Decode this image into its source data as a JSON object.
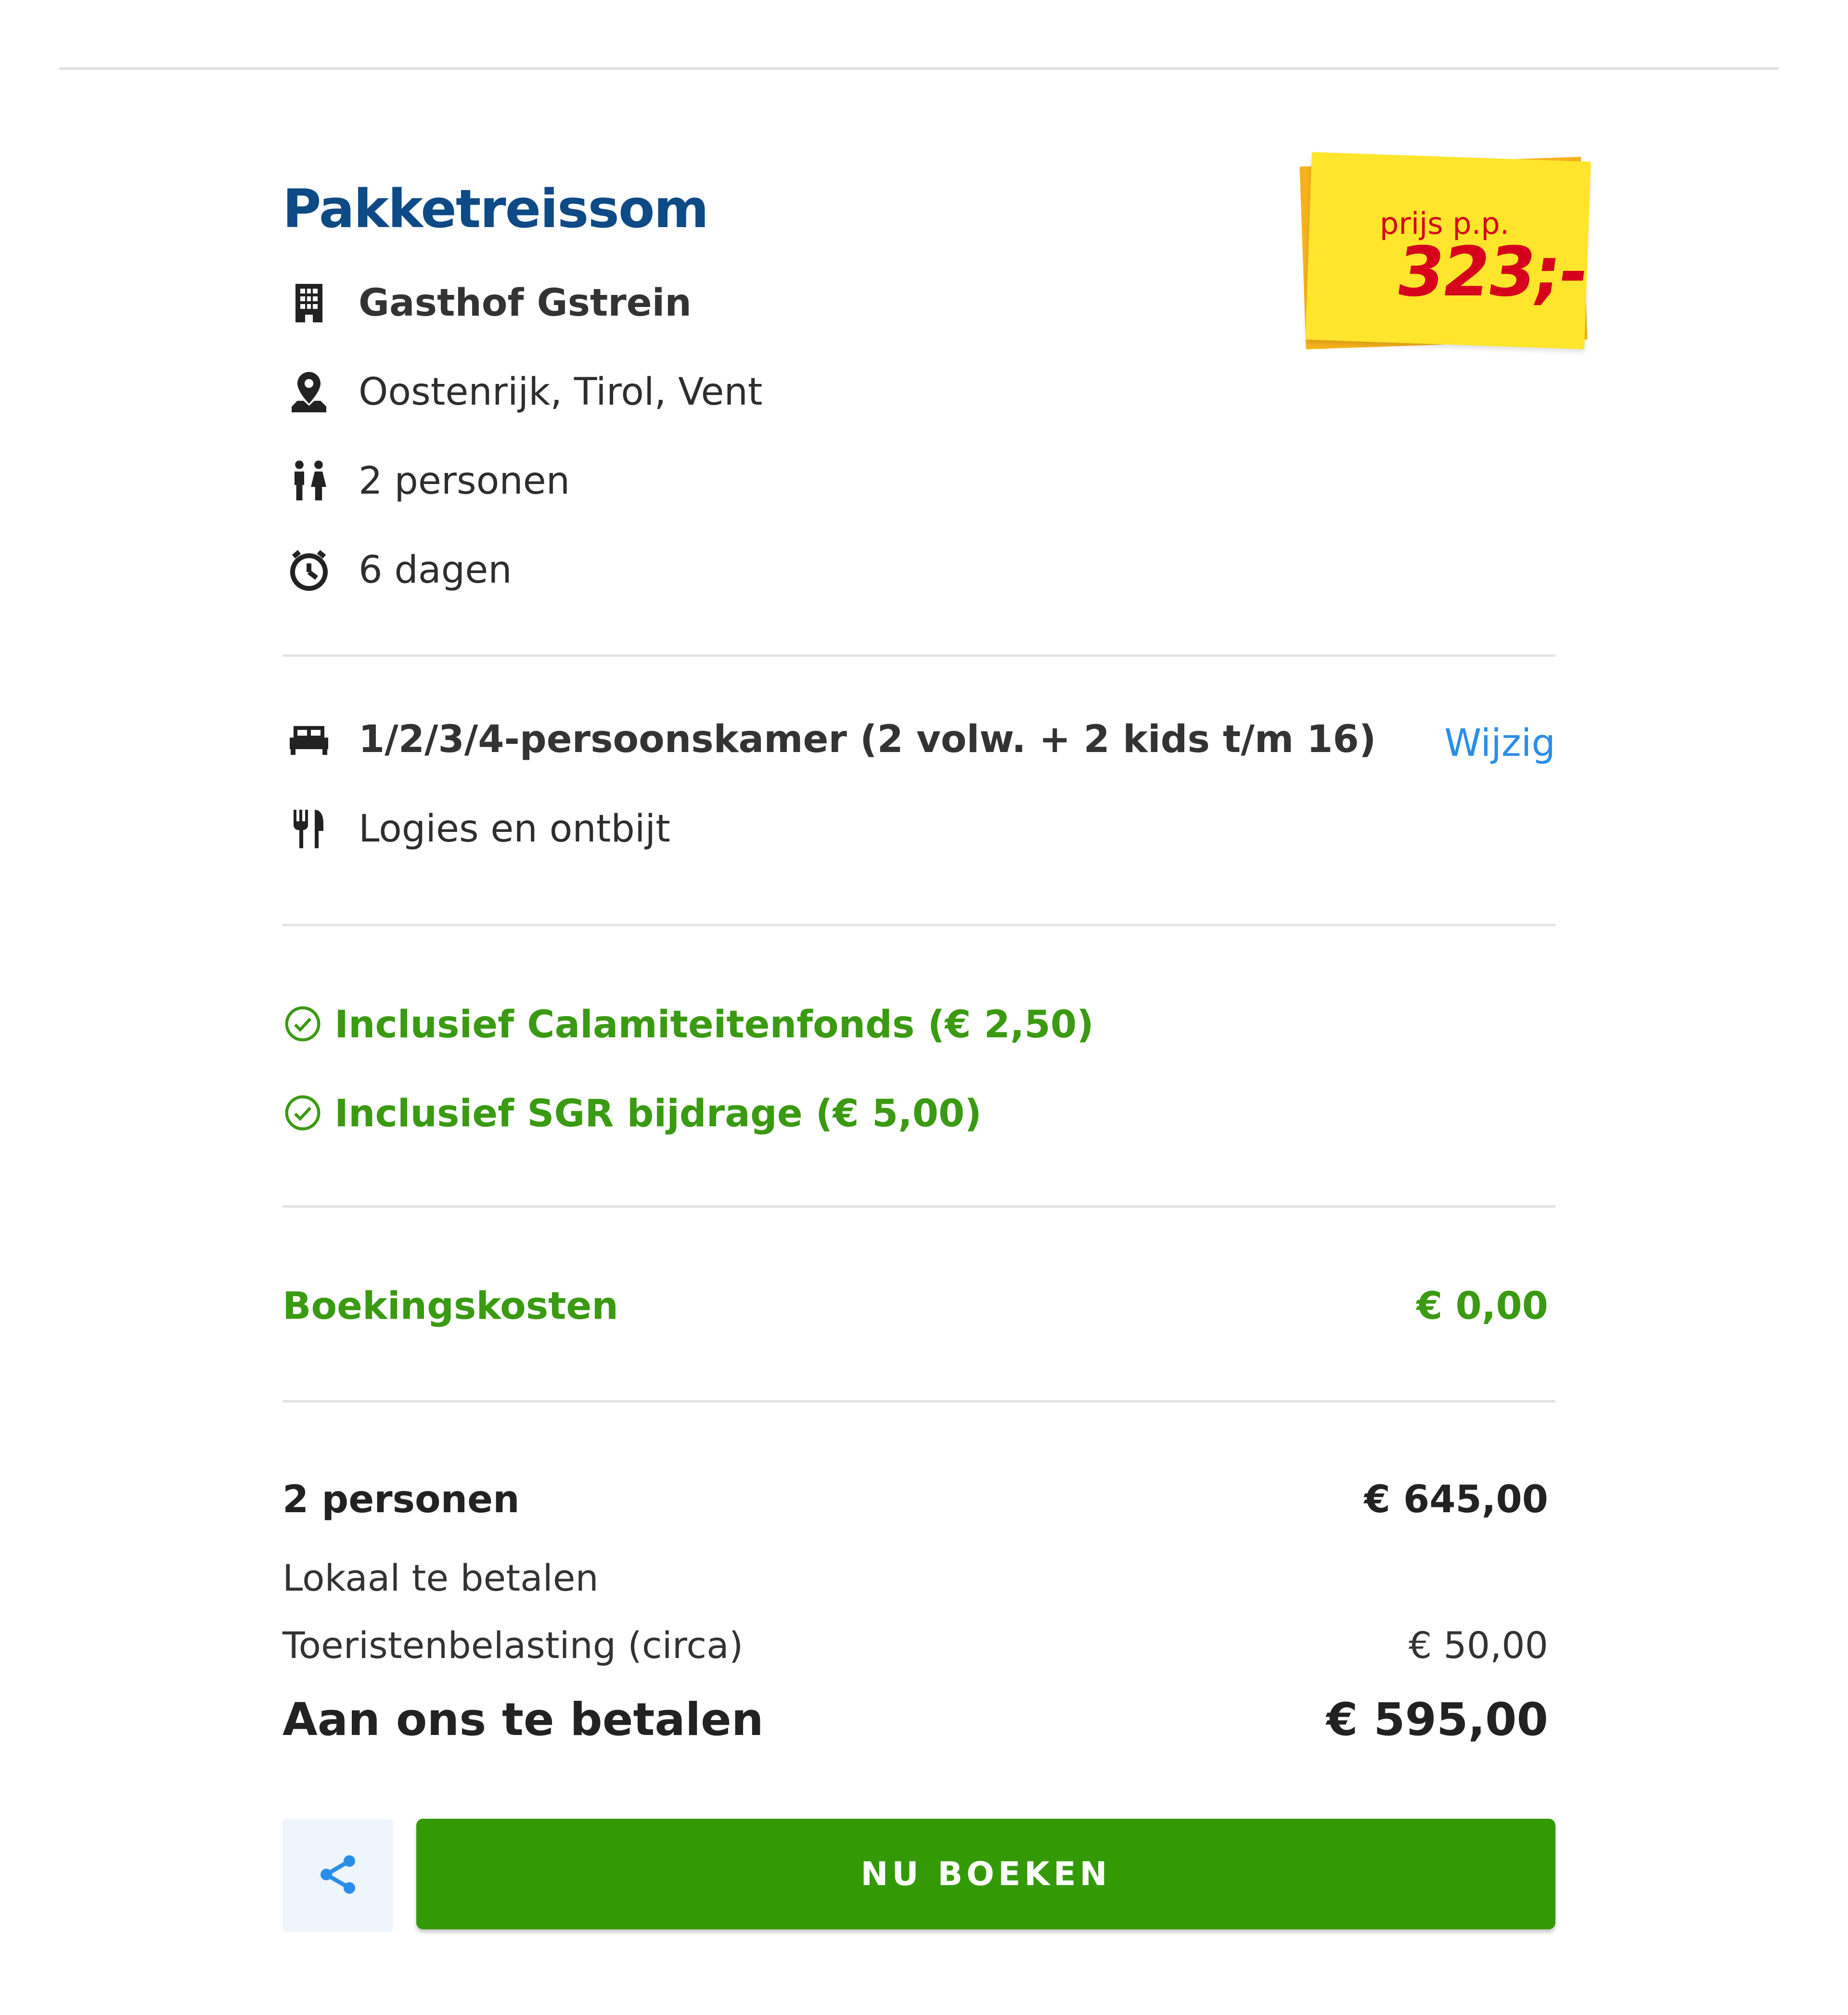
{
  "package": {
    "title": "Pakketreissom",
    "hotel": "Gasthof Gstrein",
    "location": "Oostenrijk, Tirol, Vent",
    "persons": "2 personen",
    "duration": "6 dagen"
  },
  "price_tag": {
    "label": "prijs p.p.",
    "value": "323;-"
  },
  "room": {
    "type": "1/2/3/4-persoonskamer (2 volw. + 2 kids t/m 16)",
    "change_link": "Wijzig",
    "board": "Logies en ontbijt"
  },
  "included": [
    "Inclusief Calamiteitenfonds (€ 2,50)",
    "Inclusief SGR bijdrage (€ 5,00)"
  ],
  "booking_costs": {
    "label": "Boekingskosten",
    "value": "€ 0,00"
  },
  "summary": {
    "persons_label": "2 personen",
    "persons_value": "€ 645,00",
    "local_pay_label": "Lokaal te betalen",
    "tax_label": "Toeristenbelasting (circa)",
    "tax_value": "€ 50,00",
    "total_label": "Aan ons te betalen",
    "total_value": "€ 595,00"
  },
  "actions": {
    "book_label": "NU BOEKEN",
    "share_icon": "share-icon"
  },
  "colors": {
    "title": "#0d4a86",
    "green": "#3a9a12",
    "button": "#339a05",
    "link": "#2a8ee8",
    "sticker": "#ffe52b",
    "price": "#d6001c"
  }
}
